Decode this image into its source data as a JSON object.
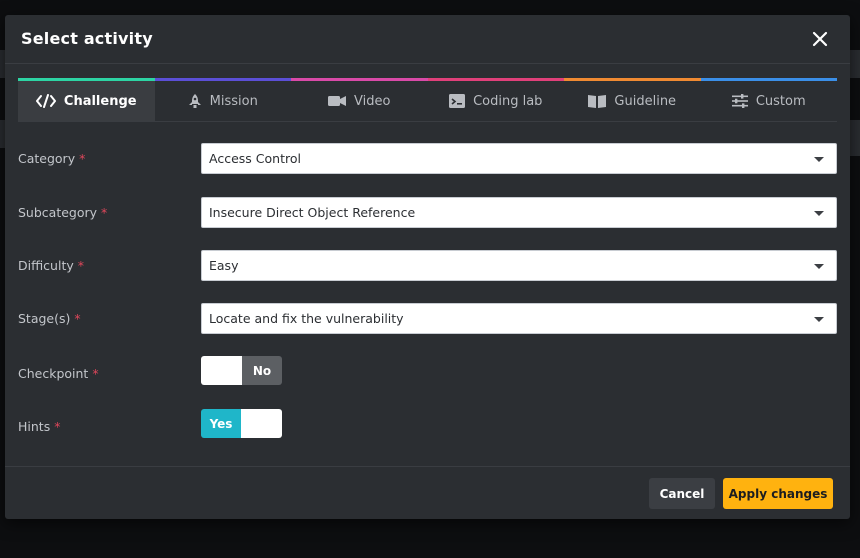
{
  "modal": {
    "title": "Select activity",
    "close_icon": "close-icon"
  },
  "tabs": [
    {
      "label": "Challenge",
      "icon": "code-icon",
      "color": "#2dd4a4",
      "active": true
    },
    {
      "label": "Mission",
      "icon": "rocket-icon",
      "color": "#5b4fd6",
      "active": false
    },
    {
      "label": "Video",
      "icon": "video-camera-icon",
      "color": "#d94aa8",
      "active": false
    },
    {
      "label": "Coding lab",
      "icon": "code-terminal-icon",
      "color": "#e0407a",
      "active": false
    },
    {
      "label": "Guideline",
      "icon": "book-icon",
      "color": "#f08a32",
      "active": false
    },
    {
      "label": "Custom",
      "icon": "sliders-icon",
      "color": "#3b8fe8",
      "active": false
    }
  ],
  "form": {
    "required_marker": "*",
    "category": {
      "label": "Category",
      "value": "Access Control"
    },
    "subcategory": {
      "label": "Subcategory",
      "value": "Insecure Direct Object Reference"
    },
    "difficulty": {
      "label": "Difficulty",
      "value": "Easy"
    },
    "stages": {
      "label": "Stage(s)",
      "value": "Locate and fix the vulnerability"
    },
    "checkpoint": {
      "label": "Checkpoint",
      "state_label": "No",
      "on": false
    },
    "hints": {
      "label": "Hints",
      "state_label": "Yes",
      "on": true
    }
  },
  "footer": {
    "cancel_label": "Cancel",
    "apply_label": "Apply changes"
  },
  "colors": {
    "accent_yes": "#1fb6c9",
    "apply_button": "#ffb20f",
    "required": "#e0475b"
  }
}
